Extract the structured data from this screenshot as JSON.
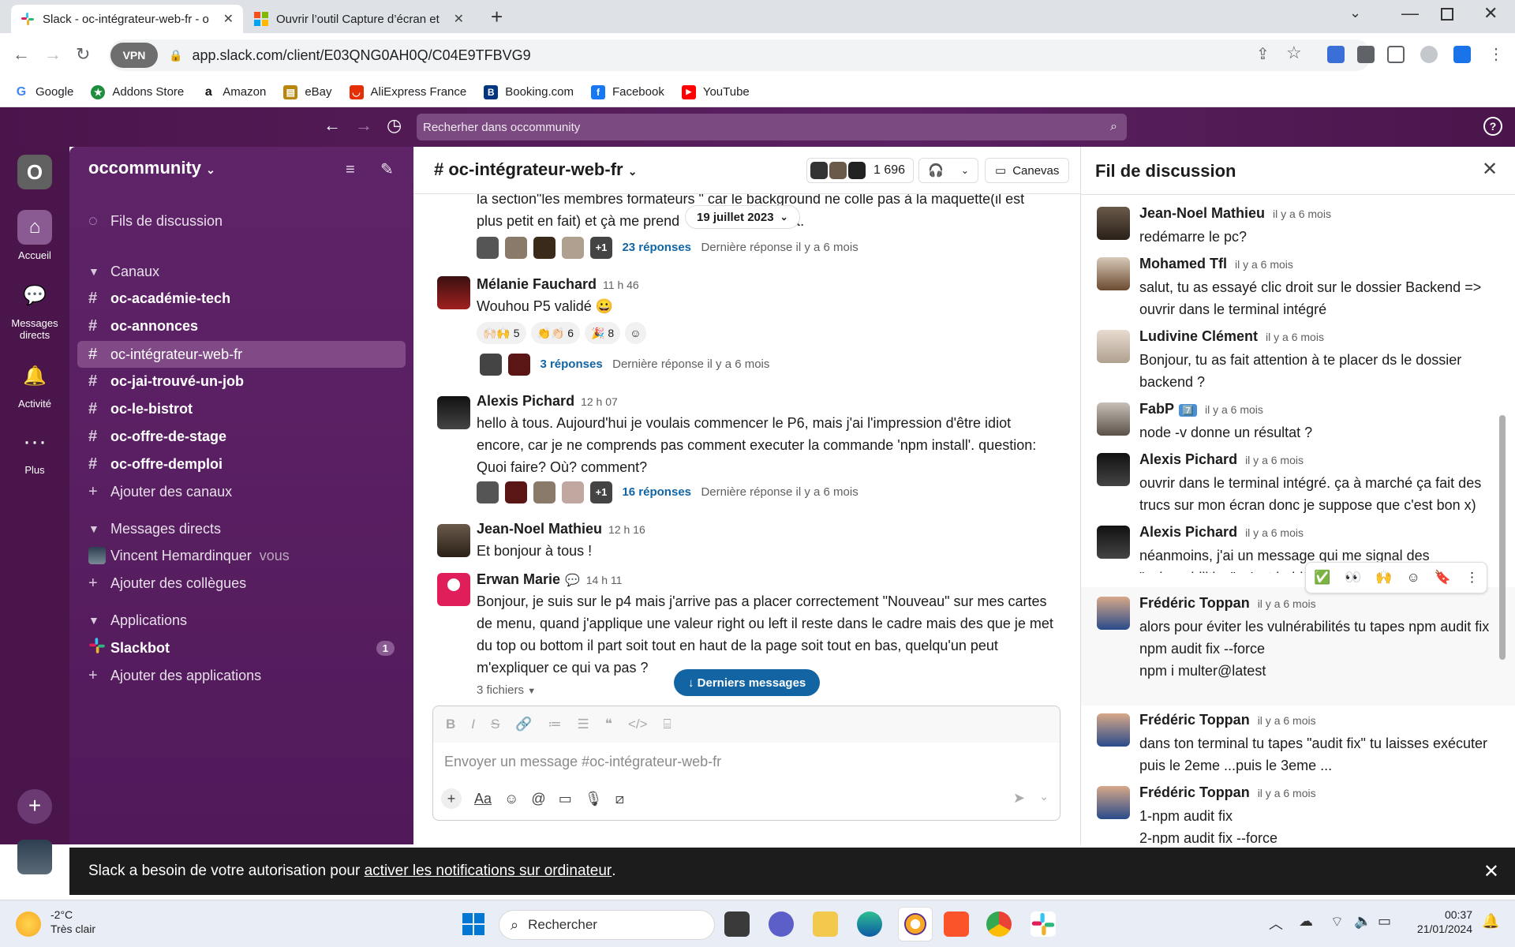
{
  "browser": {
    "tabs": [
      {
        "title": "Slack - oc-intégrateur-web-fr - o"
      },
      {
        "title": "Ouvrir l’outil Capture d’écran et"
      }
    ],
    "vpn": "VPN",
    "url": "app.slack.com/client/E03QNG0AH0Q/C04E9TFBVG9",
    "bookmarks": [
      "Google",
      "Addons Store",
      "Amazon",
      "eBay",
      "AliExpress France",
      "Booking.com",
      "Facebook",
      "YouTube"
    ]
  },
  "slack": {
    "search_placeholder": "Recherher dans occommunity",
    "rail": {
      "workspace_letter": "O",
      "home": "Accueil",
      "dms": "Messages directs",
      "activity": "Activité",
      "more": "Plus"
    },
    "sidebar": {
      "workspace": "occommunity",
      "threads": "Fils de discussion",
      "channels_header": "Canaux",
      "channels": [
        "oc-académie-tech",
        "oc-annonces",
        "oc-intégrateur-web-fr",
        "oc-jai-trouvé-un-job",
        "oc-le-bistrot",
        "oc-offre-de-stage",
        "oc-offre-demploi"
      ],
      "add_channels": "Ajouter des canaux",
      "dm_header": "Messages directs",
      "dm_user": "Vincent Hemardinquer",
      "dm_you": "vous",
      "add_colleagues": "Ajouter des collègues",
      "apps_header": "Applications",
      "slackbot": "Slackbot",
      "slackbot_badge": "1",
      "add_apps": "Ajouter des applications"
    },
    "channel": {
      "name": "# oc-intégrateur-web-fr",
      "member_count": "1 696",
      "canvas": "Canevas",
      "date_pill": "19 juillet 2023",
      "top_text_1": "la section\"les membres formateurs \" car le background ne colle pas à la maquette(il est",
      "top_text_2": "plus petit en fait) et çà me prend",
      "top_text_2b": "out.",
      "top_replies": "23 réponses",
      "top_last": "Dernière réponse il y a 6 mois",
      "messages": [
        {
          "name": "Mélanie Fauchard",
          "time": "11 h 46",
          "text": "Wouhou P5 validé 😀",
          "reactions": [
            "🙌🏻🙌 5",
            "👏👏🏻 6",
            "🎉 8"
          ],
          "replies": "3 réponses",
          "last": "Dernière réponse il y a 6 mois"
        },
        {
          "name": "Alexis Pichard",
          "time": "12 h 07",
          "text": "hello à tous. Aujourd'hui je voulais commencer le P6, mais j'ai l'impression d'être idiot encore, car je ne comprends pas comment executer la commande 'npm install'. question: Quoi faire? Où? comment?",
          "replies": "16 réponses",
          "last": "Dernière réponse il y a 6 mois"
        },
        {
          "name": "Jean-Noel Mathieu",
          "time": "12 h 16",
          "text": "Et bonjour à tous !"
        },
        {
          "name": "Erwan Marie",
          "time": "14 h 11",
          "text": "Bonjour, je suis sur le p4 mais j'arrive pas a placer correctement \"Nouveau\" sur mes cartes de menu, quand j'applique une valeur right ou left il reste dans le cadre mais des que je met du top ou bottom il part soit tout en haut de la page soit tout en bas, quelqu'un peut m'expliquer ce qui va pas ?",
          "files": "3 fichiers"
        }
      ],
      "plus_one": "+1",
      "latest_button": "↓  Derniers messages",
      "composer_placeholder": "Envoyer un message #oc-intégrateur-web-fr"
    },
    "thread": {
      "title": "Fil de discussion",
      "messages": [
        {
          "name": "Jean-Noel Mathieu",
          "time": "il y a 6 mois",
          "text": "redémarre le pc?"
        },
        {
          "name": "Mohamed Tfl",
          "time": "il y a 6 mois",
          "text": "salut, tu as essayé clic droit sur le dossier Backend => ouvrir dans le terminal intégré"
        },
        {
          "name": "Ludivine Clément",
          "time": "il y a 6 mois",
          "text": "Bonjour, tu as fait attention à te placer ds le dossier backend ?"
        },
        {
          "name": "FabP",
          "badge": "7️⃣",
          "time": "il y a 6 mois",
          "text": "node -v donne un résultat ?"
        },
        {
          "name": "Alexis Pichard",
          "time": "il y a 6 mois",
          "text": "ouvrir dans le terminal intégré. ça à marché ça fait des trucs sur mon écran donc je suppose que c'est bon x)"
        },
        {
          "name": "Alexis Pichard",
          "time": "il y a 6 mois",
          "text": "néanmoins, j'ai un message qui me signal des \"vulnerabilities\". c'est habituel? grave?"
        },
        {
          "name": "Frédéric Toppan",
          "time": "il y a 6 mois",
          "text": "alors pour éviter les vulnérabilités tu tapes npm audit fix",
          "extra": [
            "npm audit fix --force",
            "npm i multer@latest"
          ]
        },
        {
          "name": "Frédéric Toppan",
          "time": "il y a 6 mois",
          "text": "dans ton terminal tu tapes  \"audit fix\" tu laisses exécuter puis le 2eme ...puis le 3eme ..."
        },
        {
          "name": "Frédéric Toppan",
          "time": "il y a 6 mois",
          "text": "1-npm audit fix",
          "extra": [
            "2-npm audit fix --force"
          ]
        }
      ],
      "hover_actions": [
        "✅",
        "👀",
        "🙌",
        "☺",
        "🔖",
        "⋮"
      ]
    },
    "banner": {
      "prefix": "Slack a besoin de votre autorisation pour ",
      "link": "activer les notifications sur ordinateur",
      "suffix": "."
    }
  },
  "taskbar": {
    "weather_temp": "-2°C",
    "weather_desc": "Très clair",
    "search": "Rechercher",
    "time": "00:37",
    "date": "21/01/2024"
  }
}
